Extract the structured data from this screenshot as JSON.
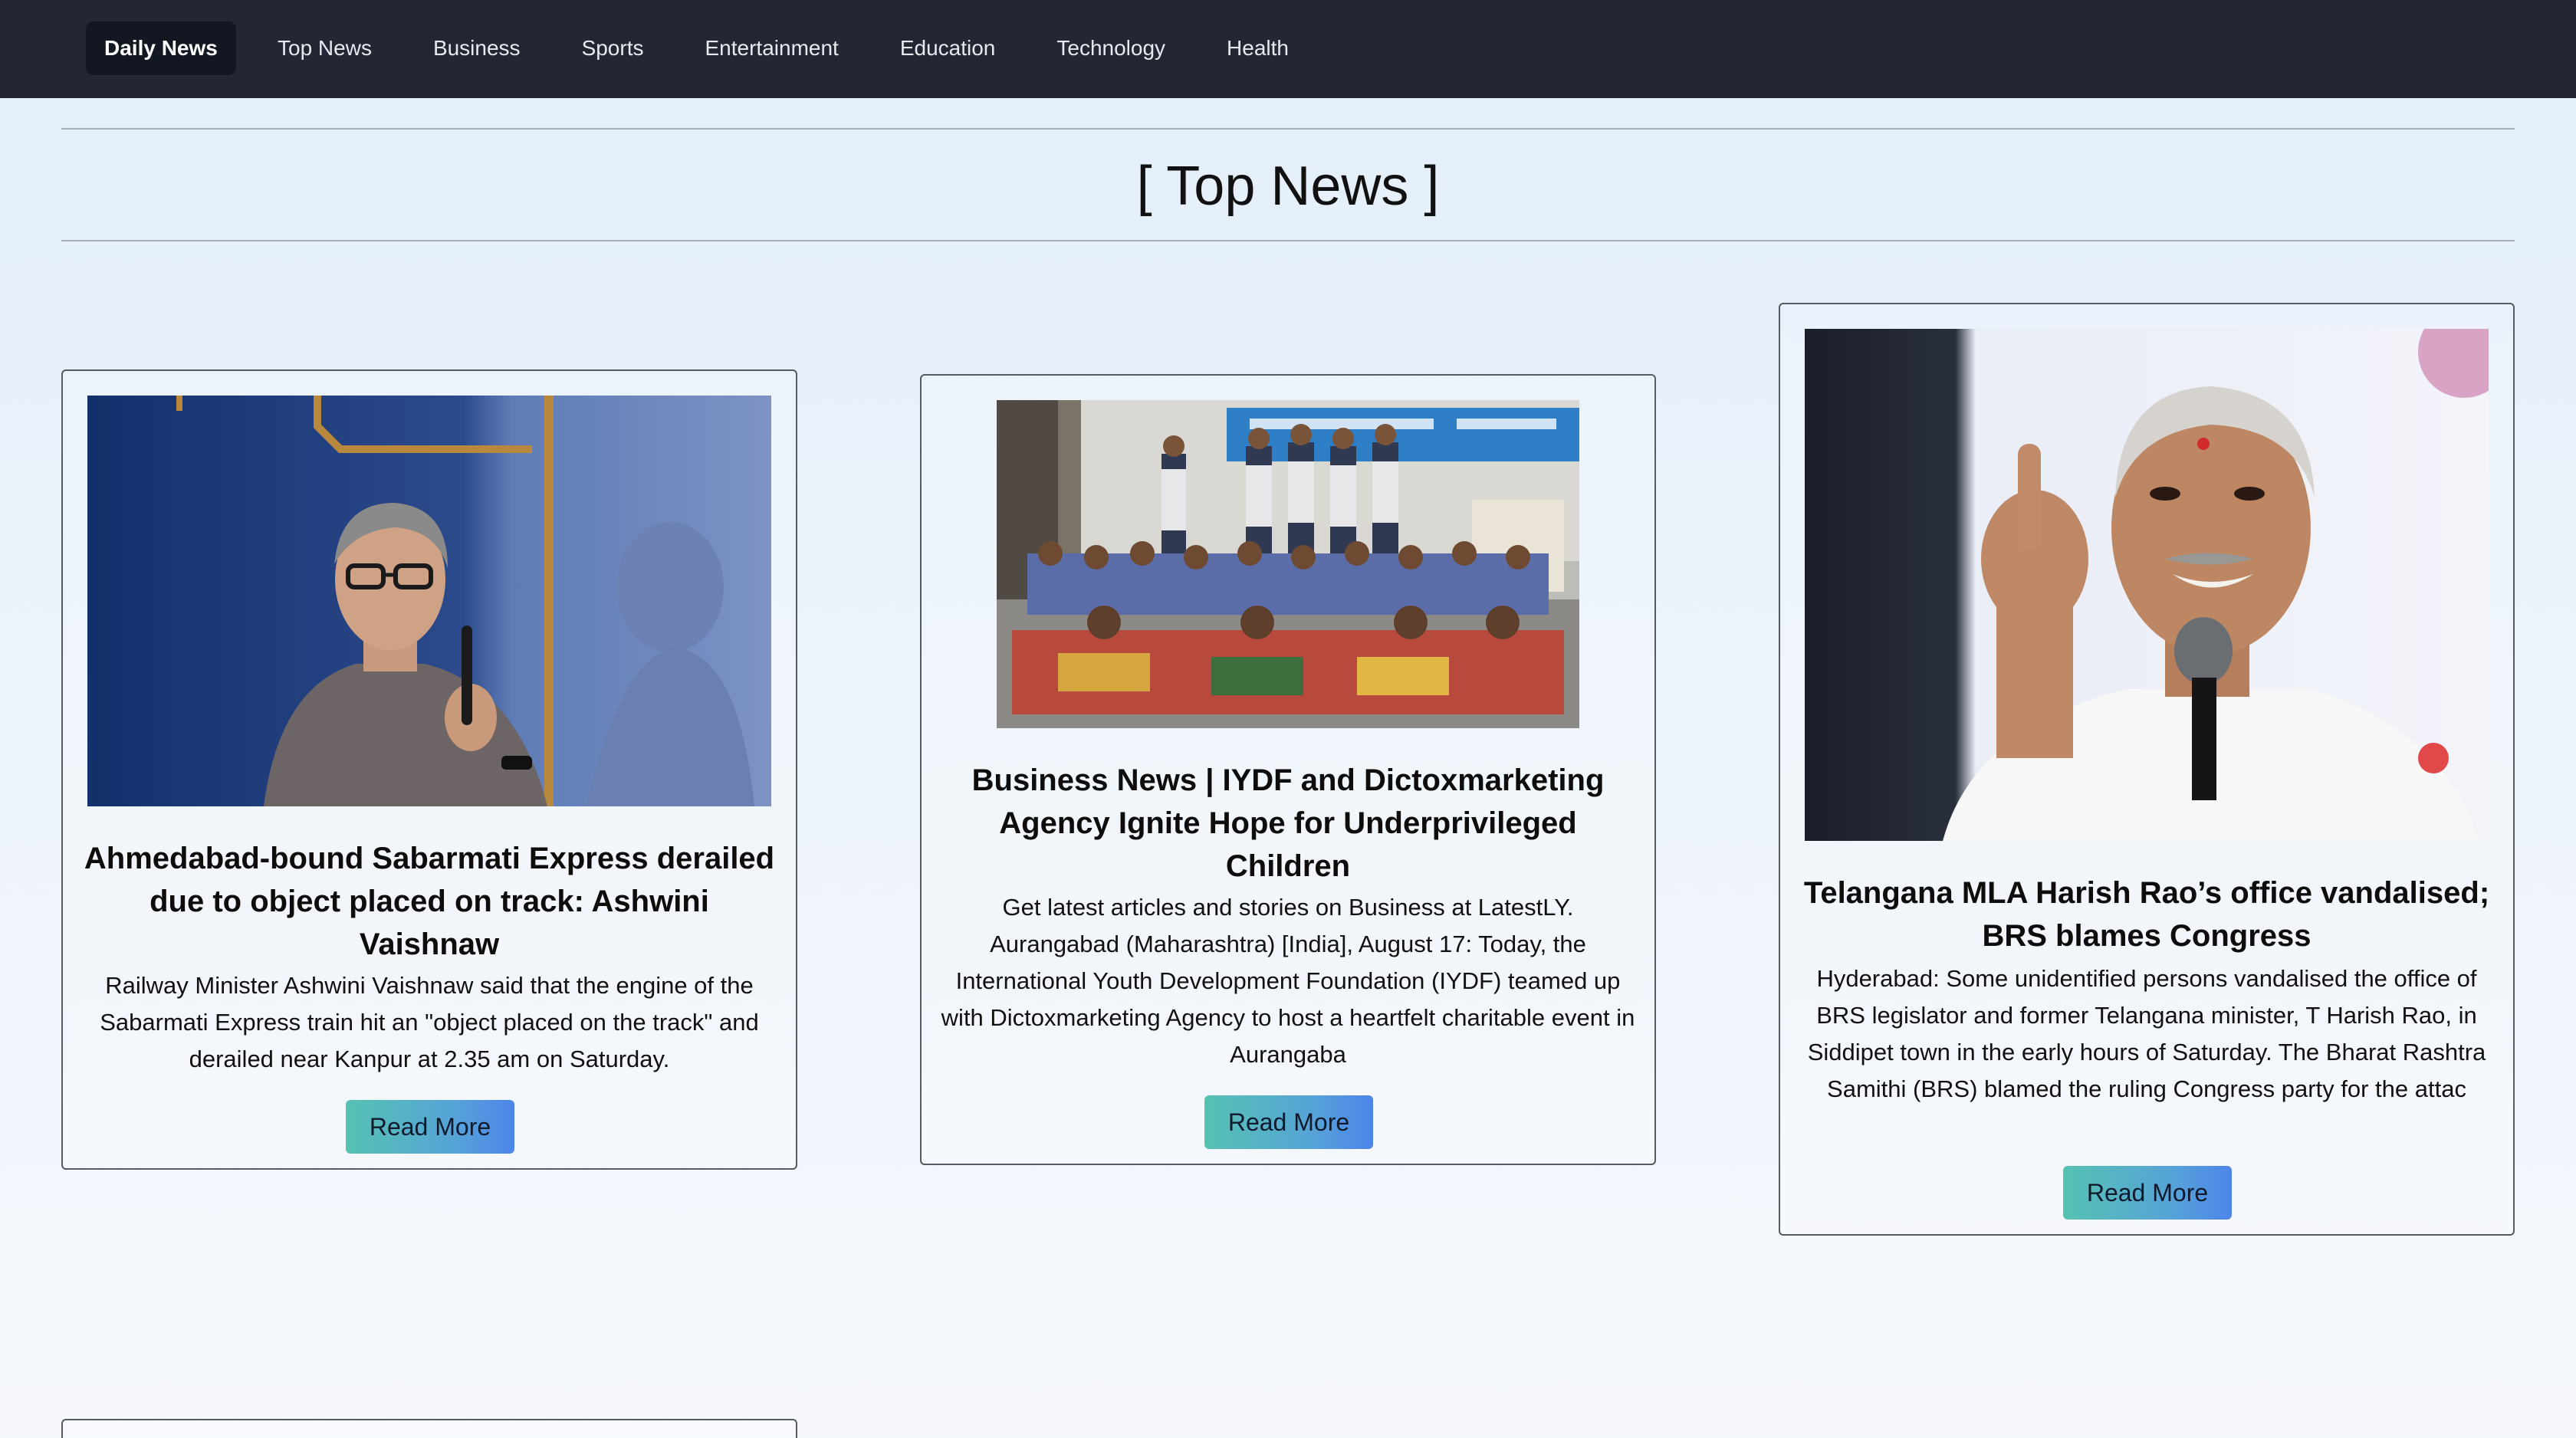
{
  "nav": {
    "brand": "Daily News",
    "links": [
      "Top News",
      "Business",
      "Sports",
      "Entertainment",
      "Education",
      "Technology",
      "Health"
    ]
  },
  "section": {
    "title": "[ Top News ]"
  },
  "cards": [
    {
      "title": "Ahmedabad-bound Sabarmati Express derailed due to object placed on track: Ashwini Vaishnaw",
      "text": "Railway Minister Ashwini Vaishnaw said that the engine of the Sabarmati Express train hit an \"object placed on the track\" and derailed near Kanpur at 2.35 am on Saturday.",
      "button": "Read More"
    },
    {
      "title": "Business News | IYDF and Dictoxmarketing Agency Ignite Hope for Underprivileged Children",
      "text": "Get latest articles and stories on Business at LatestLY. Aurangabad (Maharashtra) [India], August 17: Today, the International Youth Development Foundation (IYDF) teamed up with Dictoxmarketing Agency to host a heartfelt charitable event in Aurangaba",
      "button": "Read More"
    },
    {
      "title": "Telangana MLA Harish Rao’s office vandalised; BRS blames Congress",
      "text": "Hyderabad: Some unidentified persons vandalised the office of BRS legislator and former Telangana minister, T Harish Rao, in Siddipet town in the early hours of Saturday. The Bharat Rashtra Samithi (BRS) blamed the ruling Congress party for the attac",
      "button": "Read More"
    }
  ],
  "colors": {
    "navbar": "#222733",
    "brand_bg": "#121722",
    "button_gradient_start": "#56c2b2",
    "button_gradient_end": "#4d84ea",
    "card_border": "#555b62"
  }
}
